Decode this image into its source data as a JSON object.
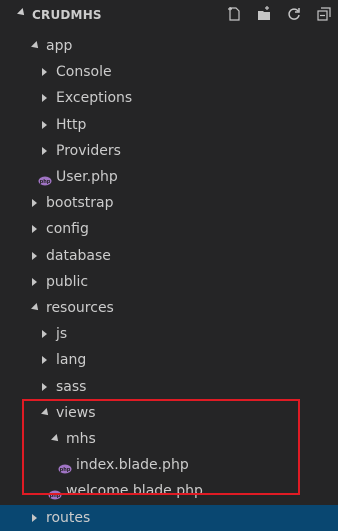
{
  "explorer": {
    "title": "CRUDMHS",
    "actions": [
      {
        "name": "new-file-icon"
      },
      {
        "name": "new-folder-icon"
      },
      {
        "name": "refresh-icon"
      },
      {
        "name": "collapse-all-icon"
      }
    ]
  },
  "tree": [
    {
      "label": "app",
      "kind": "folder",
      "expanded": true,
      "depth": 1
    },
    {
      "label": "Console",
      "kind": "folder",
      "expanded": false,
      "depth": 2
    },
    {
      "label": "Exceptions",
      "kind": "folder",
      "expanded": false,
      "depth": 2
    },
    {
      "label": "Http",
      "kind": "folder",
      "expanded": false,
      "depth": 2
    },
    {
      "label": "Providers",
      "kind": "folder",
      "expanded": false,
      "depth": 2
    },
    {
      "label": "User.php",
      "kind": "file",
      "depth": 2
    },
    {
      "label": "bootstrap",
      "kind": "folder",
      "expanded": false,
      "depth": 1
    },
    {
      "label": "config",
      "kind": "folder",
      "expanded": false,
      "depth": 1
    },
    {
      "label": "database",
      "kind": "folder",
      "expanded": false,
      "depth": 1
    },
    {
      "label": "public",
      "kind": "folder",
      "expanded": false,
      "depth": 1
    },
    {
      "label": "resources",
      "kind": "folder",
      "expanded": true,
      "depth": 1
    },
    {
      "label": "js",
      "kind": "folder",
      "expanded": false,
      "depth": 2
    },
    {
      "label": "lang",
      "kind": "folder",
      "expanded": false,
      "depth": 2
    },
    {
      "label": "sass",
      "kind": "folder",
      "expanded": false,
      "depth": 2
    },
    {
      "label": "views",
      "kind": "folder",
      "expanded": true,
      "depth": 2
    },
    {
      "label": "mhs",
      "kind": "folder",
      "expanded": true,
      "depth": 3
    },
    {
      "label": "index.blade.php",
      "kind": "file",
      "depth": 4
    },
    {
      "label": "welcome.blade.php",
      "kind": "file",
      "depth": 3
    },
    {
      "label": "routes",
      "kind": "folder",
      "expanded": false,
      "depth": 1,
      "selected": true
    }
  ],
  "colors": {
    "background": "#252526",
    "text": "#cccccc",
    "selection": "#094771",
    "php_icon": "#a074c4",
    "highlight_border": "#e01b24"
  }
}
